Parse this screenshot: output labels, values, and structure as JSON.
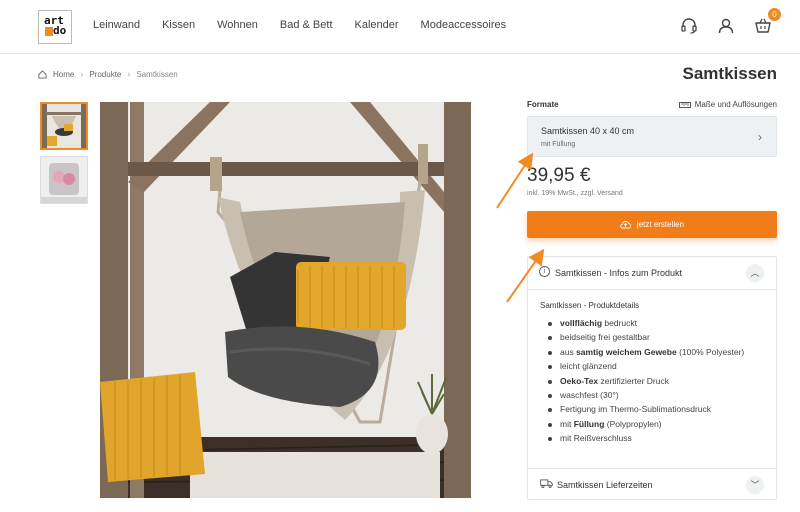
{
  "header": {
    "logo_line1": "art",
    "logo_line2": "do",
    "nav": [
      "Leinwand",
      "Kissen",
      "Wohnen",
      "Bad & Bett",
      "Kalender",
      "Modeaccessoires"
    ],
    "cart_count": "0",
    "icons": [
      "headset-icon",
      "user-icon",
      "cart-icon"
    ]
  },
  "breadcrumb": {
    "home": "Home",
    "products": "Produkte",
    "current": "Samtkissen"
  },
  "page_title": "Samtkissen",
  "formats": {
    "label": "Formate",
    "dims_link": "Maße und Auflösungen",
    "selected_name": "Samtkissen 40 x 40 cm",
    "selected_sub": "mit Füllung"
  },
  "price": {
    "value": "39,95 €",
    "note": "inkl. 19% MwSt., zzgl. Versand"
  },
  "cta": {
    "label": "jetzt erstellen"
  },
  "product_info": {
    "title": "Samtkissen - Infos zum Produkt",
    "details_title": "Samtkissen - Produktdetails",
    "items": [
      {
        "bold": "vollflächig",
        "rest": " bedruckt"
      },
      {
        "pre": "beidseitig frei gestaltbar"
      },
      {
        "pre": "aus ",
        "bold": "samtig weichem Gewebe",
        "rest": " (100% Polyester)"
      },
      {
        "pre": "leicht glänzend"
      },
      {
        "bold": "Oeko-Tex",
        "rest": " zertifizierter Druck"
      },
      {
        "pre": "waschfest (30°)"
      },
      {
        "pre": "Fertigung im Thermo-Sublimationsdruck"
      },
      {
        "pre": "mit ",
        "bold": "Füllung",
        "rest": " (Polypropylen)"
      },
      {
        "pre": "mit Reißverschluss"
      }
    ]
  },
  "delivery": {
    "title": "Samtkissen Lieferzeiten"
  },
  "colors": {
    "accent": "#f07d1a",
    "arrow": "#f08a24"
  }
}
